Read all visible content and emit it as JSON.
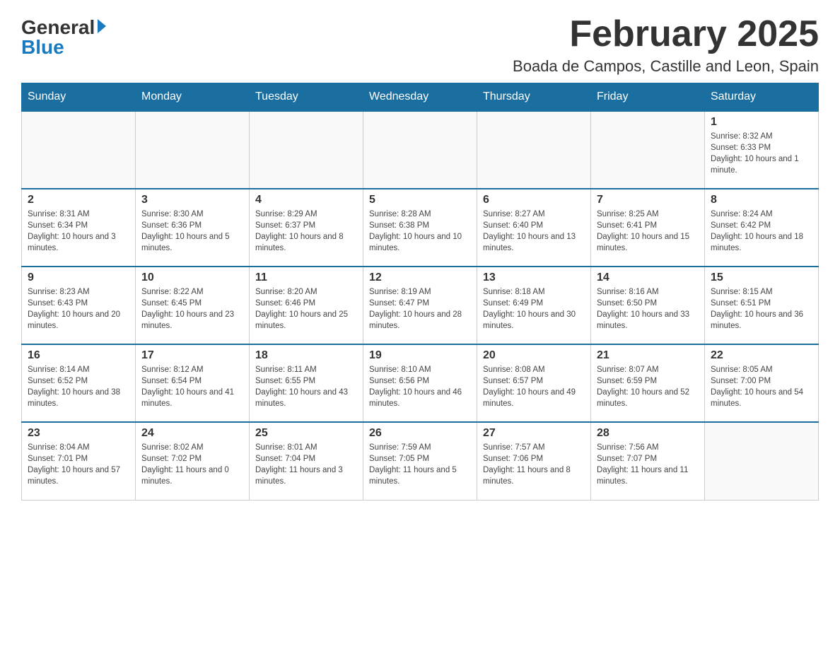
{
  "header": {
    "logo_general": "General",
    "logo_blue": "Blue",
    "title": "February 2025",
    "subtitle": "Boada de Campos, Castille and Leon, Spain"
  },
  "weekdays": [
    "Sunday",
    "Monday",
    "Tuesday",
    "Wednesday",
    "Thursday",
    "Friday",
    "Saturday"
  ],
  "weeks": [
    [
      {
        "day": "",
        "info": ""
      },
      {
        "day": "",
        "info": ""
      },
      {
        "day": "",
        "info": ""
      },
      {
        "day": "",
        "info": ""
      },
      {
        "day": "",
        "info": ""
      },
      {
        "day": "",
        "info": ""
      },
      {
        "day": "1",
        "info": "Sunrise: 8:32 AM\nSunset: 6:33 PM\nDaylight: 10 hours and 1 minute."
      }
    ],
    [
      {
        "day": "2",
        "info": "Sunrise: 8:31 AM\nSunset: 6:34 PM\nDaylight: 10 hours and 3 minutes."
      },
      {
        "day": "3",
        "info": "Sunrise: 8:30 AM\nSunset: 6:36 PM\nDaylight: 10 hours and 5 minutes."
      },
      {
        "day": "4",
        "info": "Sunrise: 8:29 AM\nSunset: 6:37 PM\nDaylight: 10 hours and 8 minutes."
      },
      {
        "day": "5",
        "info": "Sunrise: 8:28 AM\nSunset: 6:38 PM\nDaylight: 10 hours and 10 minutes."
      },
      {
        "day": "6",
        "info": "Sunrise: 8:27 AM\nSunset: 6:40 PM\nDaylight: 10 hours and 13 minutes."
      },
      {
        "day": "7",
        "info": "Sunrise: 8:25 AM\nSunset: 6:41 PM\nDaylight: 10 hours and 15 minutes."
      },
      {
        "day": "8",
        "info": "Sunrise: 8:24 AM\nSunset: 6:42 PM\nDaylight: 10 hours and 18 minutes."
      }
    ],
    [
      {
        "day": "9",
        "info": "Sunrise: 8:23 AM\nSunset: 6:43 PM\nDaylight: 10 hours and 20 minutes."
      },
      {
        "day": "10",
        "info": "Sunrise: 8:22 AM\nSunset: 6:45 PM\nDaylight: 10 hours and 23 minutes."
      },
      {
        "day": "11",
        "info": "Sunrise: 8:20 AM\nSunset: 6:46 PM\nDaylight: 10 hours and 25 minutes."
      },
      {
        "day": "12",
        "info": "Sunrise: 8:19 AM\nSunset: 6:47 PM\nDaylight: 10 hours and 28 minutes."
      },
      {
        "day": "13",
        "info": "Sunrise: 8:18 AM\nSunset: 6:49 PM\nDaylight: 10 hours and 30 minutes."
      },
      {
        "day": "14",
        "info": "Sunrise: 8:16 AM\nSunset: 6:50 PM\nDaylight: 10 hours and 33 minutes."
      },
      {
        "day": "15",
        "info": "Sunrise: 8:15 AM\nSunset: 6:51 PM\nDaylight: 10 hours and 36 minutes."
      }
    ],
    [
      {
        "day": "16",
        "info": "Sunrise: 8:14 AM\nSunset: 6:52 PM\nDaylight: 10 hours and 38 minutes."
      },
      {
        "day": "17",
        "info": "Sunrise: 8:12 AM\nSunset: 6:54 PM\nDaylight: 10 hours and 41 minutes."
      },
      {
        "day": "18",
        "info": "Sunrise: 8:11 AM\nSunset: 6:55 PM\nDaylight: 10 hours and 43 minutes."
      },
      {
        "day": "19",
        "info": "Sunrise: 8:10 AM\nSunset: 6:56 PM\nDaylight: 10 hours and 46 minutes."
      },
      {
        "day": "20",
        "info": "Sunrise: 8:08 AM\nSunset: 6:57 PM\nDaylight: 10 hours and 49 minutes."
      },
      {
        "day": "21",
        "info": "Sunrise: 8:07 AM\nSunset: 6:59 PM\nDaylight: 10 hours and 52 minutes."
      },
      {
        "day": "22",
        "info": "Sunrise: 8:05 AM\nSunset: 7:00 PM\nDaylight: 10 hours and 54 minutes."
      }
    ],
    [
      {
        "day": "23",
        "info": "Sunrise: 8:04 AM\nSunset: 7:01 PM\nDaylight: 10 hours and 57 minutes."
      },
      {
        "day": "24",
        "info": "Sunrise: 8:02 AM\nSunset: 7:02 PM\nDaylight: 11 hours and 0 minutes."
      },
      {
        "day": "25",
        "info": "Sunrise: 8:01 AM\nSunset: 7:04 PM\nDaylight: 11 hours and 3 minutes."
      },
      {
        "day": "26",
        "info": "Sunrise: 7:59 AM\nSunset: 7:05 PM\nDaylight: 11 hours and 5 minutes."
      },
      {
        "day": "27",
        "info": "Sunrise: 7:57 AM\nSunset: 7:06 PM\nDaylight: 11 hours and 8 minutes."
      },
      {
        "day": "28",
        "info": "Sunrise: 7:56 AM\nSunset: 7:07 PM\nDaylight: 11 hours and 11 minutes."
      },
      {
        "day": "",
        "info": ""
      }
    ]
  ]
}
